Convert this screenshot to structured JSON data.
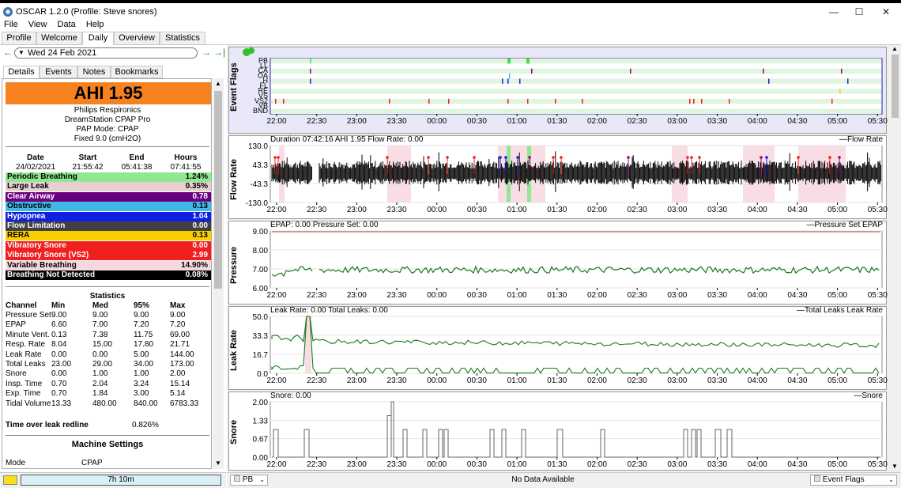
{
  "window": {
    "title": "OSCAR 1.2.0 (Profile: Steve snores)",
    "min": "—",
    "max": "☐",
    "close": "✕"
  },
  "menu": [
    "File",
    "View",
    "Data",
    "Help"
  ],
  "tabs": [
    "Profile",
    "Welcome",
    "Daily",
    "Overview",
    "Statistics"
  ],
  "date_nav": {
    "date": "Wed 24 Feb 2021"
  },
  "subtabs": [
    "Details",
    "Events",
    "Notes",
    "Bookmarks"
  ],
  "ahi_label": "AHI 1.95",
  "machine": [
    "Philips Respironics",
    "DreamStation CPAP Pro",
    "PAP Mode: CPAP",
    "Fixed 9.0 (cmH2O)"
  ],
  "session_header": [
    "Date",
    "Start",
    "End",
    "Hours"
  ],
  "session": [
    "24/02/2021",
    "21:55:42",
    "05:41:38",
    "07:41:55"
  ],
  "events": [
    {
      "name": "Periodic Breathing",
      "value": "1.24%",
      "bg": "#90e890",
      "fg": "#000"
    },
    {
      "name": "Large Leak",
      "value": "0.35%",
      "bg": "#e8d0d0",
      "fg": "#000"
    },
    {
      "name": "Clear Airway",
      "value": "0.78",
      "bg": "#6a0080",
      "fg": "#fff"
    },
    {
      "name": "Obstructive",
      "value": "0.13",
      "bg": "#40b8e8",
      "fg": "#000"
    },
    {
      "name": "Hypopnea",
      "value": "1.04",
      "bg": "#1020e0",
      "fg": "#fff"
    },
    {
      "name": "Flow Limitation",
      "value": "0.00",
      "bg": "#404040",
      "fg": "#fff"
    },
    {
      "name": "RERA",
      "value": "0.13",
      "bg": "#f8d000",
      "fg": "#000"
    },
    {
      "name": "Vibratory Snore",
      "value": "0.00",
      "bg": "#f02020",
      "fg": "#fff"
    },
    {
      "name": "Vibratory Snore (VS2)",
      "value": "2.99",
      "bg": "#f02020",
      "fg": "#fff"
    },
    {
      "name": "Variable Breathing",
      "value": "14.90%",
      "bg": "#f8d8e0",
      "fg": "#000"
    },
    {
      "name": "Breathing Not Detected",
      "value": "0.08%",
      "bg": "#000000",
      "fg": "#fff"
    }
  ],
  "stats_title": "Statistics",
  "stats_header": [
    "Channel",
    "Min",
    "Med",
    "95%",
    "Max"
  ],
  "stats": [
    [
      "Pressure Set",
      "9.00",
      "9.00",
      "9.00",
      "9.00"
    ],
    [
      "EPAP",
      "6.60",
      "7.00",
      "7.20",
      "7.20"
    ],
    [
      "Minute Vent.",
      "0.13",
      "7.38",
      "11.75",
      "69.00"
    ],
    [
      "Resp. Rate",
      "8.04",
      "15.00",
      "17.80",
      "21.71"
    ],
    [
      "Leak Rate",
      "0.00",
      "0.00",
      "5.00",
      "144.00"
    ],
    [
      "Total Leaks",
      "23.00",
      "29.00",
      "34.00",
      "173.00"
    ],
    [
      "Snore",
      "0.00",
      "1.00",
      "1.00",
      "2.00"
    ],
    [
      "Insp. Time",
      "0.70",
      "2.04",
      "3.24",
      "15.14"
    ],
    [
      "Exp. Time",
      "0.70",
      "1.84",
      "3.00",
      "5.14"
    ],
    [
      "Tidal Volume",
      "13.33",
      "480.00",
      "840.00",
      "6783.33"
    ]
  ],
  "leak_redline": {
    "label": "Time over leak redline",
    "value": "0.826%"
  },
  "machine_settings_title": "Machine Settings",
  "mode": {
    "label": "Mode",
    "value": "CPAP"
  },
  "bottom_left": {
    "duration": "7h 10m"
  },
  "time_ticks": [
    "22:00",
    "22:30",
    "23:00",
    "23:30",
    "00:00",
    "00:30",
    "01:00",
    "01:30",
    "02:00",
    "02:30",
    "03:00",
    "03:30",
    "04:00",
    "04:30",
    "05:00",
    "05:30"
  ],
  "event_flags": {
    "ylabel": "Event Flags",
    "rows": [
      "PB",
      "LL",
      "CA",
      "OA",
      "H",
      "FL",
      "RE",
      "VS",
      "VS2",
      "VB",
      "BND"
    ]
  },
  "flow": {
    "ylabel": "Flow Rate",
    "title": "Duration 07:42:16 AHI 1.95 Flow Rate: 0.00",
    "legend": "Flow Rate",
    "yticks": [
      "130.0",
      "43.3",
      "-43.3",
      "-130.0"
    ]
  },
  "pressure": {
    "ylabel": "Pressure",
    "title": "EPAP: 0.00 Pressure Set: 0.00",
    "legend": "Pressure Set EPAP",
    "yticks": [
      "9.00",
      "8.00",
      "7.00",
      "6.00"
    ]
  },
  "leak": {
    "ylabel": "Leak Rate",
    "title": "Leak Rate: 0.00 Total Leaks: 0.00",
    "legend": "Total Leaks Leak Rate",
    "yticks": [
      "50.0",
      "33.3",
      "16.7",
      "0.0"
    ]
  },
  "snore": {
    "ylabel": "Snore",
    "title": "Snore: 0.00",
    "legend": "Snore",
    "yticks": [
      "2.00",
      "1.33",
      "0.67",
      "0.00"
    ]
  },
  "bottom_right": {
    "left_select": "PB",
    "center": "No Data Available",
    "right_select": "Event Flags"
  }
}
